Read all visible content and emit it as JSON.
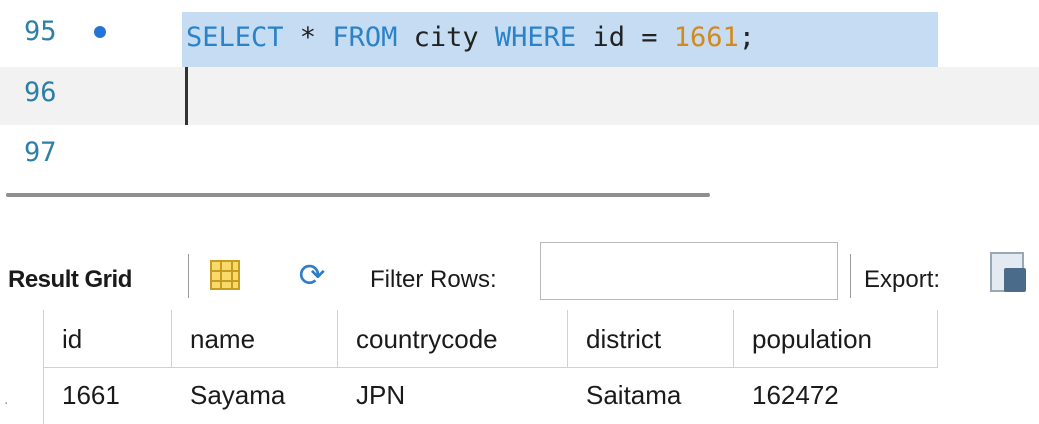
{
  "editor": {
    "lines": [
      {
        "number": "95",
        "has_bullet": true
      },
      {
        "number": "96"
      },
      {
        "number": "97"
      }
    ],
    "query_tokens": {
      "kw_select": "SELECT",
      "star": " * ",
      "kw_from": "FROM",
      "table": " city ",
      "kw_where": "WHERE",
      "condition": " id = ",
      "value": "1661",
      "terminator": ";"
    }
  },
  "toolbar": {
    "result_grid_label": "Result Grid",
    "filter_rows_label": "Filter Rows:",
    "filter_value": "",
    "export_label": "Export:"
  },
  "grid": {
    "columns": [
      "id",
      "name",
      "countrycode",
      "district",
      "population"
    ],
    "rows": [
      [
        "1661",
        "Sayama",
        "JPN",
        "Saitama",
        "162472"
      ]
    ]
  },
  "colors": {
    "keyword": "#2a82c9",
    "number": "#d2891e",
    "selection": "#c5dcf2",
    "line_number": "#2c7fa6"
  }
}
